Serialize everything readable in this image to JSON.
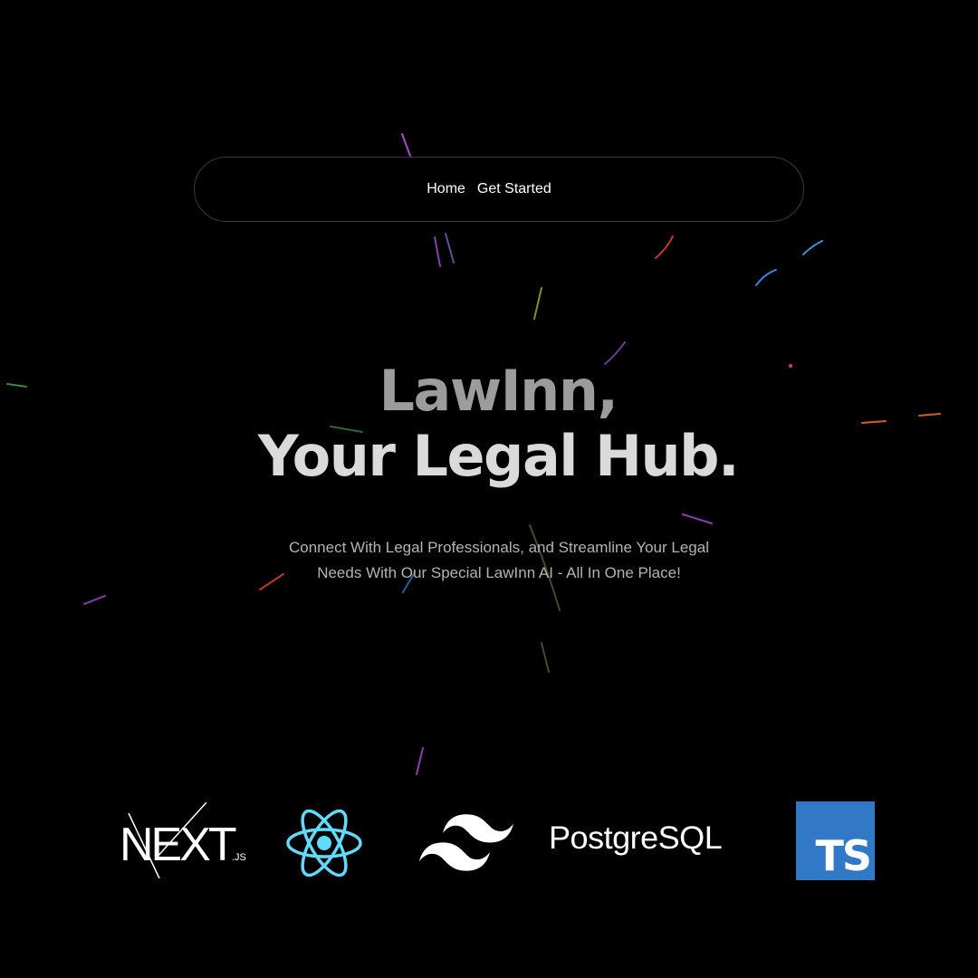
{
  "nav": {
    "home_label": "Home",
    "get_started_label": "Get Started"
  },
  "hero": {
    "title_line1": "LawInn,",
    "title_line2": "Your Legal Hub.",
    "subtitle_line1": "Connect With Legal Professionals, and Streamline Your Legal",
    "subtitle_line2": "Needs With Our Special LawInn AI - All In One Place!"
  },
  "tech_logos": {
    "next": {
      "text": "NEXT",
      "suffix": ".JS",
      "icon": "nextjs-logo"
    },
    "react": {
      "icon": "react-logo",
      "color": "#61dafb"
    },
    "tailwind": {
      "icon": "tailwind-logo",
      "color": "#ffffff"
    },
    "postgres": {
      "text": "PostgreSQL",
      "icon": "postgresql-wordmark"
    },
    "typescript": {
      "text": "TS",
      "icon": "typescript-logo",
      "color": "#3178c6"
    }
  },
  "colors": {
    "background": "#000000",
    "title_line1": "#9c9c9c",
    "title_line2": "#dadada",
    "subtitle": "#b3b3b3",
    "nav_border": "#3a3a3a"
  }
}
